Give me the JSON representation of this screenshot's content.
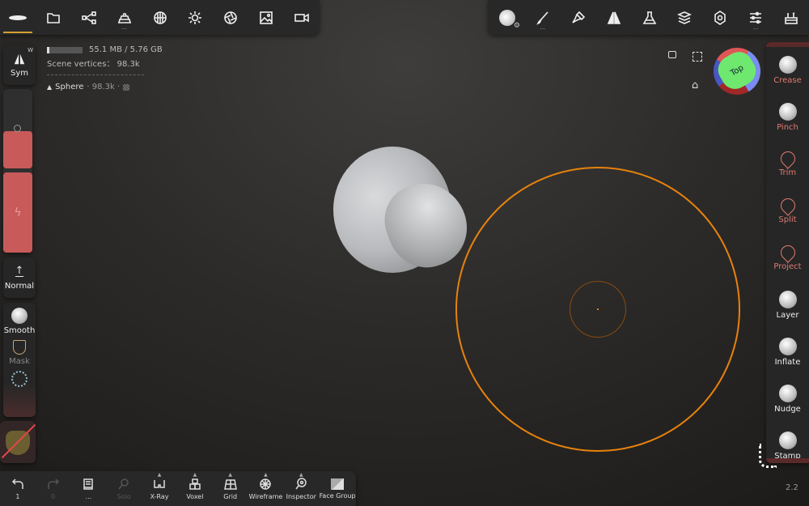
{
  "top_left_toolbar": [
    {
      "icon": "scene-icon",
      "active": true
    },
    {
      "icon": "folder-icon"
    },
    {
      "icon": "share-nodes-icon"
    },
    {
      "icon": "gold-bars-icon",
      "more": "..."
    },
    {
      "icon": "sphere-grid-icon"
    },
    {
      "icon": "sun-icon"
    },
    {
      "icon": "aperture-icon"
    },
    {
      "icon": "image-icon"
    },
    {
      "icon": "video-camera-icon"
    }
  ],
  "top_right_toolbar": [
    {
      "icon": "material-ball-icon"
    },
    {
      "icon": "brush-icon",
      "more": "..."
    },
    {
      "icon": "paint-brush-icon"
    },
    {
      "icon": "symmetry-icon"
    },
    {
      "icon": "flask-icon"
    },
    {
      "icon": "layers-icon"
    },
    {
      "icon": "gear-icon"
    },
    {
      "icon": "sliders-icon",
      "more": "..."
    },
    {
      "icon": "toolbox-icon"
    }
  ],
  "info": {
    "memory": "55.1 MB / 5.76 GB",
    "memory_fraction": 0.0096,
    "vertices": "Scene vertices： 98.3k",
    "object_name": "Sphere",
    "object_info": "· 98.3k ·"
  },
  "left": {
    "sym": "Sym",
    "sym_badge": "W",
    "normal": "Normal",
    "smooth": "Smooth",
    "mask": "Mask"
  },
  "gizmo": {
    "face": "Top"
  },
  "right_tools": [
    {
      "label": "Crease",
      "style": "ball"
    },
    {
      "label": "Pinch",
      "style": "ball"
    },
    {
      "label": "Trim",
      "style": "red"
    },
    {
      "label": "Split",
      "style": "red"
    },
    {
      "label": "Project",
      "style": "red"
    },
    {
      "label": "Layer",
      "style": "ball"
    },
    {
      "label": "Inflate",
      "style": "ball"
    },
    {
      "label": "Nudge",
      "style": "ball"
    },
    {
      "label": "Stamp",
      "style": "ball"
    }
  ],
  "bottom": {
    "undo": "1",
    "redo": "0",
    "more": "...",
    "solo": "Solo",
    "xray": "X-Ray",
    "voxel": "Voxel",
    "grid": "Grid",
    "wireframe": "Wireframe",
    "inspector": "Inspector",
    "facegroup": "Face Group"
  },
  "version": "2.2",
  "colors": {
    "accent": "#e8820c",
    "tool_red": "#c85a5a"
  }
}
